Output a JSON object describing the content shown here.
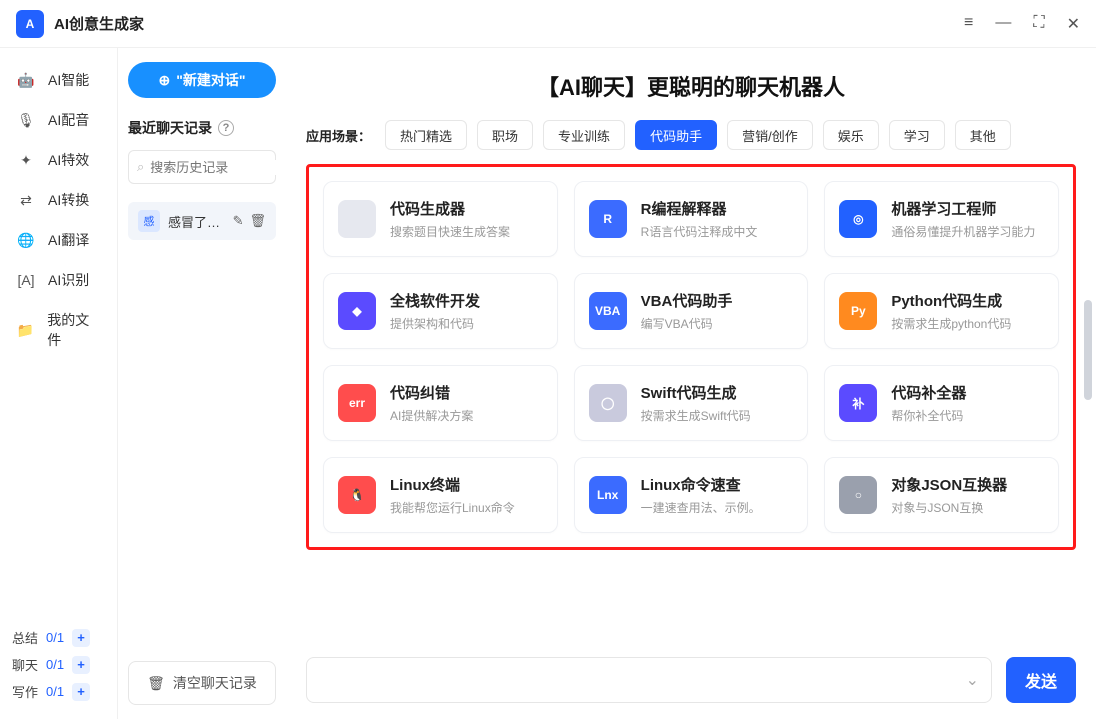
{
  "app": {
    "title": "AI创意生成家",
    "logo_text": "A"
  },
  "window_controls": {
    "menu": "≡",
    "minimize": "—",
    "maximize": "⛶",
    "close": "✕"
  },
  "sidebar": {
    "items": [
      {
        "label": "AI智能",
        "icon": "robot-icon"
      },
      {
        "label": "AI配音",
        "icon": "mic-icon"
      },
      {
        "label": "AI特效",
        "icon": "sparkle-icon"
      },
      {
        "label": "AI转换",
        "icon": "swap-icon"
      },
      {
        "label": "AI翻译",
        "icon": "translate-icon"
      },
      {
        "label": "AI识别",
        "icon": "scan-icon"
      },
      {
        "label": "我的文件",
        "icon": "folder-icon"
      }
    ],
    "footer": [
      {
        "label": "总结",
        "count": "0/1"
      },
      {
        "label": "聊天",
        "count": "0/1"
      },
      {
        "label": "写作",
        "count": "0/1"
      }
    ]
  },
  "col2": {
    "new_chat": "\"新建对话\"",
    "recent_label": "最近聊天记录",
    "search_placeholder": "搜索历史记录",
    "history_item": {
      "badge": "感",
      "text": "感冒了能…"
    },
    "clear_button": "清空聊天记录"
  },
  "main": {
    "title": "【AI聊天】更聪明的聊天机器人",
    "scene_label": "应用场景：",
    "scenes": [
      {
        "label": "热门精选",
        "active": false
      },
      {
        "label": "职场",
        "active": false
      },
      {
        "label": "专业训练",
        "active": false
      },
      {
        "label": "代码助手",
        "active": true
      },
      {
        "label": "营销/创作",
        "active": false
      },
      {
        "label": "娱乐",
        "active": false
      },
      {
        "label": "学习",
        "active": false
      },
      {
        "label": "其他",
        "active": false
      }
    ],
    "cards": [
      {
        "title": "代码生成器",
        "sub": "搜索题目快速生成答案",
        "icon_bg": "#e6e8ef",
        "icon_fg": "#888",
        "icon_text": "</>"
      },
      {
        "title": "R编程解释器",
        "sub": "R语言代码注释成中文",
        "icon_bg": "#3b6bff",
        "icon_fg": "#fff",
        "icon_text": "R"
      },
      {
        "title": "机器学习工程师",
        "sub": "通俗易懂提升机器学习能力",
        "icon_bg": "#2261ff",
        "icon_fg": "#fff",
        "icon_text": "◎"
      },
      {
        "title": "全栈软件开发",
        "sub": "提供架构和代码",
        "icon_bg": "#5b4bff",
        "icon_fg": "#fff",
        "icon_text": "◆"
      },
      {
        "title": "VBA代码助手",
        "sub": "编写VBA代码",
        "icon_bg": "#3b6bff",
        "icon_fg": "#fff",
        "icon_text": "VBA"
      },
      {
        "title": "Python代码生成",
        "sub": "按需求生成python代码",
        "icon_bg": "#ff8a1f",
        "icon_fg": "#fff",
        "icon_text": "Py"
      },
      {
        "title": "代码纠错",
        "sub": "AI提供解决方案",
        "icon_bg": "#ff4d4d",
        "icon_fg": "#fff",
        "icon_text": "err"
      },
      {
        "title": "Swift代码生成",
        "sub": "按需求生成Swift代码",
        "icon_bg": "#c9cadd",
        "icon_fg": "#fff",
        "icon_text": "◯"
      },
      {
        "title": "代码补全器",
        "sub": "帮你补全代码",
        "icon_bg": "#5b4bff",
        "icon_fg": "#fff",
        "icon_text": "补"
      },
      {
        "title": "Linux终端",
        "sub": "我能帮您运行Linux命令",
        "icon_bg": "#ff4d4d",
        "icon_fg": "#fff",
        "icon_text": "🐧"
      },
      {
        "title": "Linux命令速查",
        "sub": "一建速查用法、示例。",
        "icon_bg": "#3b6bff",
        "icon_fg": "#fff",
        "icon_text": "Lnx"
      },
      {
        "title": "对象JSON互换器",
        "sub": "对象与JSON互换",
        "icon_bg": "#9aa0ad",
        "icon_fg": "#fff",
        "icon_text": "○"
      }
    ],
    "send_label": "发送"
  }
}
